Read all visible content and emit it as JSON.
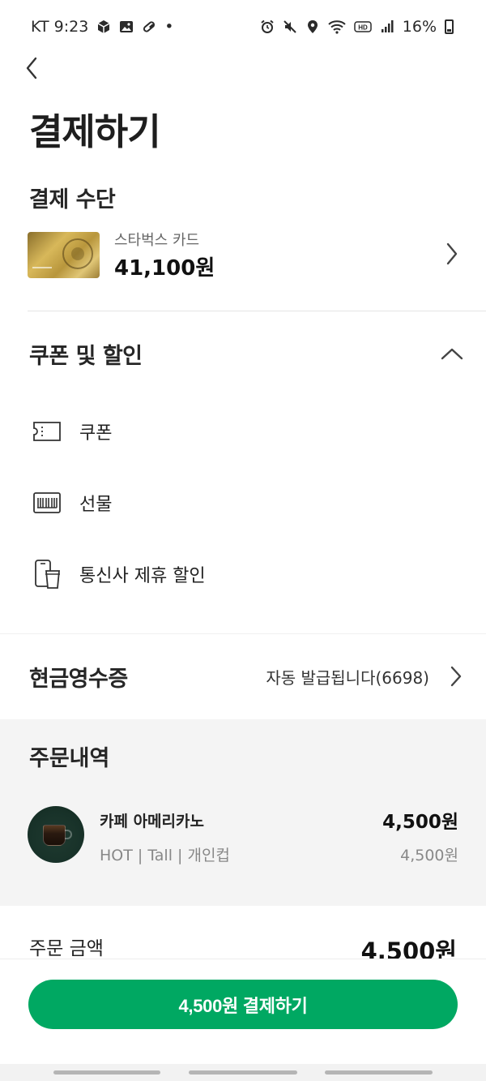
{
  "status_bar": {
    "carrier_time": "KT 9:23",
    "dot": "•",
    "battery": "16%",
    "left_icons": [
      "cube-icon",
      "gallery-icon",
      "pill-icon"
    ],
    "right_icons": [
      "alarm-icon",
      "mute-icon",
      "location-icon",
      "wifi-icon",
      "hd-icon",
      "signal-icon",
      "battery-icon"
    ]
  },
  "header": {
    "back_icon": "chevron-left-icon",
    "title": "결제하기"
  },
  "payment_method": {
    "heading": "결제 수단",
    "card_name": "스타벅스 카드",
    "card_balance": "41,100원"
  },
  "coupon_discount": {
    "heading": "쿠폰 및 할인",
    "items": [
      {
        "label": "쿠폰",
        "icon": "ticket-icon"
      },
      {
        "label": "선물",
        "icon": "gift-card-icon"
      },
      {
        "label": "통신사 제휴 할인",
        "icon": "phone-cup-icon"
      }
    ]
  },
  "cash_receipt": {
    "heading": "현금영수증",
    "value": "자동 발급됩니다(6698)"
  },
  "order": {
    "heading": "주문내역",
    "items": [
      {
        "name": "카페 아메리카노",
        "options": "HOT | Tall | 개인컵",
        "price": "4,500원",
        "unit_price": "4,500원"
      }
    ]
  },
  "total": {
    "label": "주문 금액",
    "value": "4,500원"
  },
  "pay_button": {
    "label": "4,500원 결제하기"
  },
  "colors": {
    "accent": "#00a862",
    "section_bg": "#f4f4f4"
  }
}
